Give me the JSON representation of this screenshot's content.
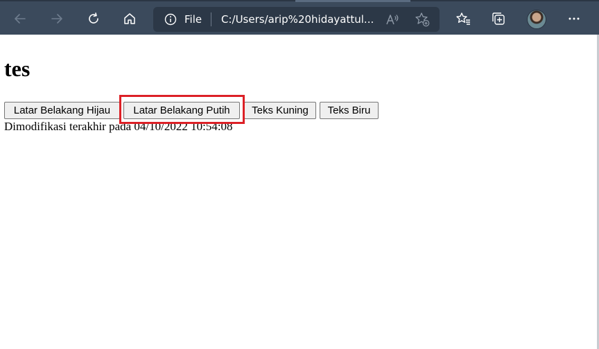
{
  "browser": {
    "address_bar": {
      "scheme_label": "File",
      "url": "C:/Users/arip%20hidayattul..."
    },
    "icons": {
      "back": "back-arrow-icon",
      "forward": "forward-arrow-icon",
      "refresh": "refresh-icon",
      "home": "home-icon",
      "info": "info-icon",
      "read_aloud": "read-aloud-icon",
      "add_favorite": "add-favorite-icon",
      "favorites": "favorites-icon",
      "collections": "collections-icon",
      "profile": "profile-avatar",
      "more": "more-icon"
    },
    "toolbar_color": "#3b4a5c",
    "address_bar_color": "#2c3847"
  },
  "page": {
    "title": "tes",
    "buttons": [
      {
        "label": "Latar Belakang Hijau"
      },
      {
        "label": "Latar Belakang Putih"
      },
      {
        "label": "Teks Kuning"
      },
      {
        "label": "Teks Biru"
      }
    ],
    "last_modified": "Dimodifikasi terakhir pada 04/10/2022 10:54:08",
    "highlight_color": "#dc2026",
    "highlighted_button": "Latar Belakang Putih"
  }
}
